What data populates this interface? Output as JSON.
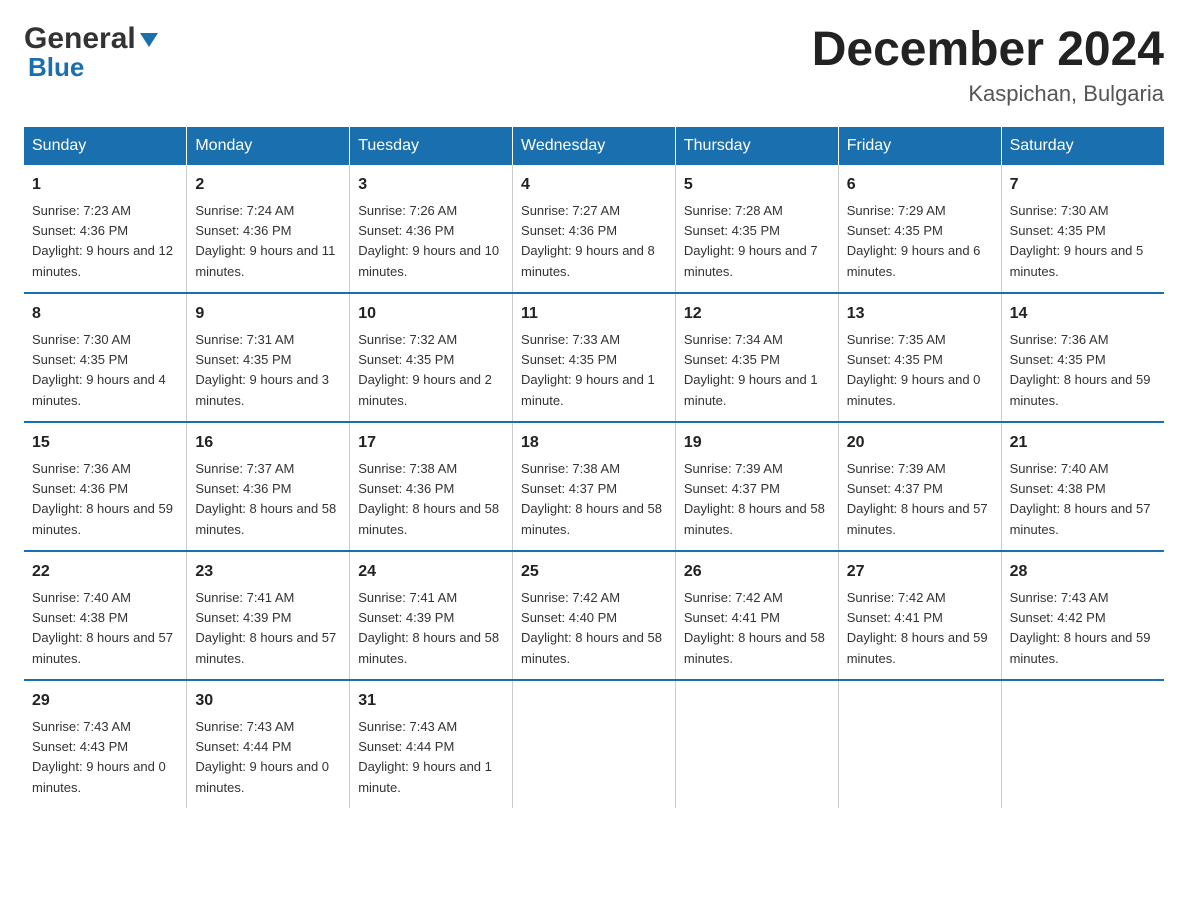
{
  "logo": {
    "general_text": "General",
    "blue_text": "Blue"
  },
  "title": "December 2024",
  "subtitle": "Kaspichan, Bulgaria",
  "days_of_week": [
    "Sunday",
    "Monday",
    "Tuesday",
    "Wednesday",
    "Thursday",
    "Friday",
    "Saturday"
  ],
  "weeks": [
    [
      {
        "day": "1",
        "sunrise": "Sunrise: 7:23 AM",
        "sunset": "Sunset: 4:36 PM",
        "daylight": "Daylight: 9 hours and 12 minutes."
      },
      {
        "day": "2",
        "sunrise": "Sunrise: 7:24 AM",
        "sunset": "Sunset: 4:36 PM",
        "daylight": "Daylight: 9 hours and 11 minutes."
      },
      {
        "day": "3",
        "sunrise": "Sunrise: 7:26 AM",
        "sunset": "Sunset: 4:36 PM",
        "daylight": "Daylight: 9 hours and 10 minutes."
      },
      {
        "day": "4",
        "sunrise": "Sunrise: 7:27 AM",
        "sunset": "Sunset: 4:36 PM",
        "daylight": "Daylight: 9 hours and 8 minutes."
      },
      {
        "day": "5",
        "sunrise": "Sunrise: 7:28 AM",
        "sunset": "Sunset: 4:35 PM",
        "daylight": "Daylight: 9 hours and 7 minutes."
      },
      {
        "day": "6",
        "sunrise": "Sunrise: 7:29 AM",
        "sunset": "Sunset: 4:35 PM",
        "daylight": "Daylight: 9 hours and 6 minutes."
      },
      {
        "day": "7",
        "sunrise": "Sunrise: 7:30 AM",
        "sunset": "Sunset: 4:35 PM",
        "daylight": "Daylight: 9 hours and 5 minutes."
      }
    ],
    [
      {
        "day": "8",
        "sunrise": "Sunrise: 7:30 AM",
        "sunset": "Sunset: 4:35 PM",
        "daylight": "Daylight: 9 hours and 4 minutes."
      },
      {
        "day": "9",
        "sunrise": "Sunrise: 7:31 AM",
        "sunset": "Sunset: 4:35 PM",
        "daylight": "Daylight: 9 hours and 3 minutes."
      },
      {
        "day": "10",
        "sunrise": "Sunrise: 7:32 AM",
        "sunset": "Sunset: 4:35 PM",
        "daylight": "Daylight: 9 hours and 2 minutes."
      },
      {
        "day": "11",
        "sunrise": "Sunrise: 7:33 AM",
        "sunset": "Sunset: 4:35 PM",
        "daylight": "Daylight: 9 hours and 1 minute."
      },
      {
        "day": "12",
        "sunrise": "Sunrise: 7:34 AM",
        "sunset": "Sunset: 4:35 PM",
        "daylight": "Daylight: 9 hours and 1 minute."
      },
      {
        "day": "13",
        "sunrise": "Sunrise: 7:35 AM",
        "sunset": "Sunset: 4:35 PM",
        "daylight": "Daylight: 9 hours and 0 minutes."
      },
      {
        "day": "14",
        "sunrise": "Sunrise: 7:36 AM",
        "sunset": "Sunset: 4:35 PM",
        "daylight": "Daylight: 8 hours and 59 minutes."
      }
    ],
    [
      {
        "day": "15",
        "sunrise": "Sunrise: 7:36 AM",
        "sunset": "Sunset: 4:36 PM",
        "daylight": "Daylight: 8 hours and 59 minutes."
      },
      {
        "day": "16",
        "sunrise": "Sunrise: 7:37 AM",
        "sunset": "Sunset: 4:36 PM",
        "daylight": "Daylight: 8 hours and 58 minutes."
      },
      {
        "day": "17",
        "sunrise": "Sunrise: 7:38 AM",
        "sunset": "Sunset: 4:36 PM",
        "daylight": "Daylight: 8 hours and 58 minutes."
      },
      {
        "day": "18",
        "sunrise": "Sunrise: 7:38 AM",
        "sunset": "Sunset: 4:37 PM",
        "daylight": "Daylight: 8 hours and 58 minutes."
      },
      {
        "day": "19",
        "sunrise": "Sunrise: 7:39 AM",
        "sunset": "Sunset: 4:37 PM",
        "daylight": "Daylight: 8 hours and 58 minutes."
      },
      {
        "day": "20",
        "sunrise": "Sunrise: 7:39 AM",
        "sunset": "Sunset: 4:37 PM",
        "daylight": "Daylight: 8 hours and 57 minutes."
      },
      {
        "day": "21",
        "sunrise": "Sunrise: 7:40 AM",
        "sunset": "Sunset: 4:38 PM",
        "daylight": "Daylight: 8 hours and 57 minutes."
      }
    ],
    [
      {
        "day": "22",
        "sunrise": "Sunrise: 7:40 AM",
        "sunset": "Sunset: 4:38 PM",
        "daylight": "Daylight: 8 hours and 57 minutes."
      },
      {
        "day": "23",
        "sunrise": "Sunrise: 7:41 AM",
        "sunset": "Sunset: 4:39 PM",
        "daylight": "Daylight: 8 hours and 57 minutes."
      },
      {
        "day": "24",
        "sunrise": "Sunrise: 7:41 AM",
        "sunset": "Sunset: 4:39 PM",
        "daylight": "Daylight: 8 hours and 58 minutes."
      },
      {
        "day": "25",
        "sunrise": "Sunrise: 7:42 AM",
        "sunset": "Sunset: 4:40 PM",
        "daylight": "Daylight: 8 hours and 58 minutes."
      },
      {
        "day": "26",
        "sunrise": "Sunrise: 7:42 AM",
        "sunset": "Sunset: 4:41 PM",
        "daylight": "Daylight: 8 hours and 58 minutes."
      },
      {
        "day": "27",
        "sunrise": "Sunrise: 7:42 AM",
        "sunset": "Sunset: 4:41 PM",
        "daylight": "Daylight: 8 hours and 59 minutes."
      },
      {
        "day": "28",
        "sunrise": "Sunrise: 7:43 AM",
        "sunset": "Sunset: 4:42 PM",
        "daylight": "Daylight: 8 hours and 59 minutes."
      }
    ],
    [
      {
        "day": "29",
        "sunrise": "Sunrise: 7:43 AM",
        "sunset": "Sunset: 4:43 PM",
        "daylight": "Daylight: 9 hours and 0 minutes."
      },
      {
        "day": "30",
        "sunrise": "Sunrise: 7:43 AM",
        "sunset": "Sunset: 4:44 PM",
        "daylight": "Daylight: 9 hours and 0 minutes."
      },
      {
        "day": "31",
        "sunrise": "Sunrise: 7:43 AM",
        "sunset": "Sunset: 4:44 PM",
        "daylight": "Daylight: 9 hours and 1 minute."
      },
      null,
      null,
      null,
      null
    ]
  ]
}
